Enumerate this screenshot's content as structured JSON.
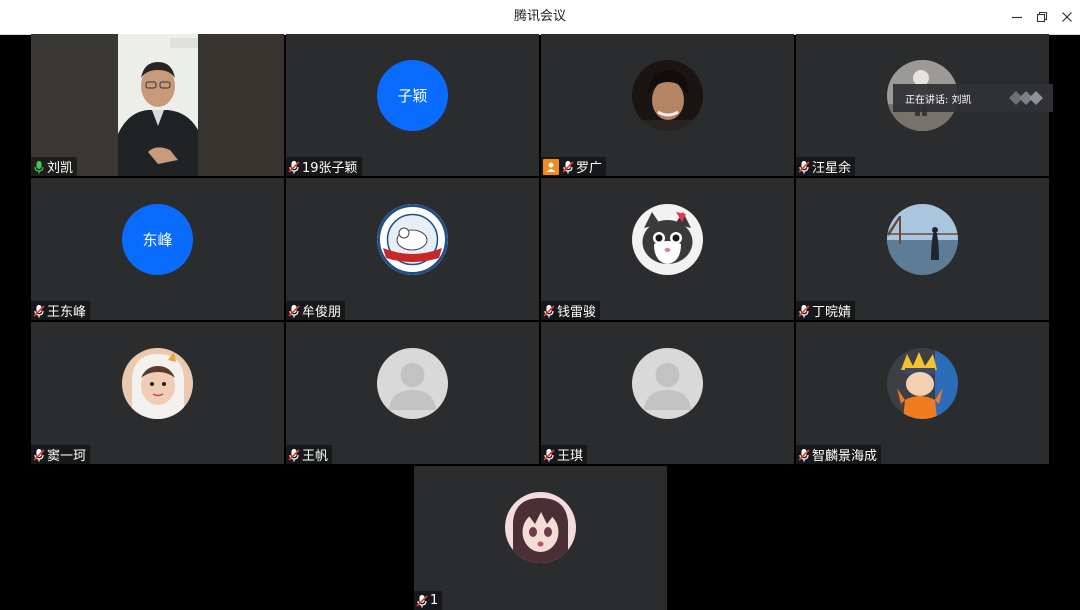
{
  "window": {
    "title": "腾讯会议"
  },
  "speaking_toast": {
    "text": "正在讲话: 刘凯"
  },
  "participants": [
    {
      "name": "刘凯",
      "avatar_text": "",
      "mic": "active",
      "avatar": "video"
    },
    {
      "name": "19张子颖",
      "avatar_text": "子颖",
      "mic": "muted",
      "avatar": "text"
    },
    {
      "name": "罗广",
      "avatar_text": "",
      "mic": "muted",
      "avatar": "photo-man"
    },
    {
      "name": "汪星余",
      "avatar_text": "",
      "mic": "muted",
      "avatar": "photo-child"
    },
    {
      "name": "王东峰",
      "avatar_text": "东峰",
      "mic": "muted",
      "avatar": "text"
    },
    {
      "name": "牟俊朋",
      "avatar_text": "",
      "mic": "muted",
      "avatar": "emblem"
    },
    {
      "name": "钱雷骏",
      "avatar_text": "",
      "mic": "muted",
      "avatar": "cat"
    },
    {
      "name": "丁晥婧",
      "avatar_text": "",
      "mic": "muted",
      "avatar": "bridge"
    },
    {
      "name": "窦一珂",
      "avatar_text": "",
      "mic": "muted",
      "avatar": "girl"
    },
    {
      "name": "王帆",
      "avatar_text": "",
      "mic": "muted",
      "avatar": "default"
    },
    {
      "name": "王琪",
      "avatar_text": "",
      "mic": "muted",
      "avatar": "default"
    },
    {
      "name": "智麟景海成",
      "avatar_text": "",
      "mic": "muted",
      "avatar": "ninja"
    },
    {
      "name": "1",
      "avatar_text": "",
      "mic": "muted",
      "avatar": "anime"
    }
  ],
  "colors": {
    "tile_bg": "#2b2c2e",
    "accent_blue": "#0a6cff",
    "mic_active": "#3cc85a",
    "mic_muted": "#e23b3b",
    "camera_badge": "#f28a1c"
  }
}
